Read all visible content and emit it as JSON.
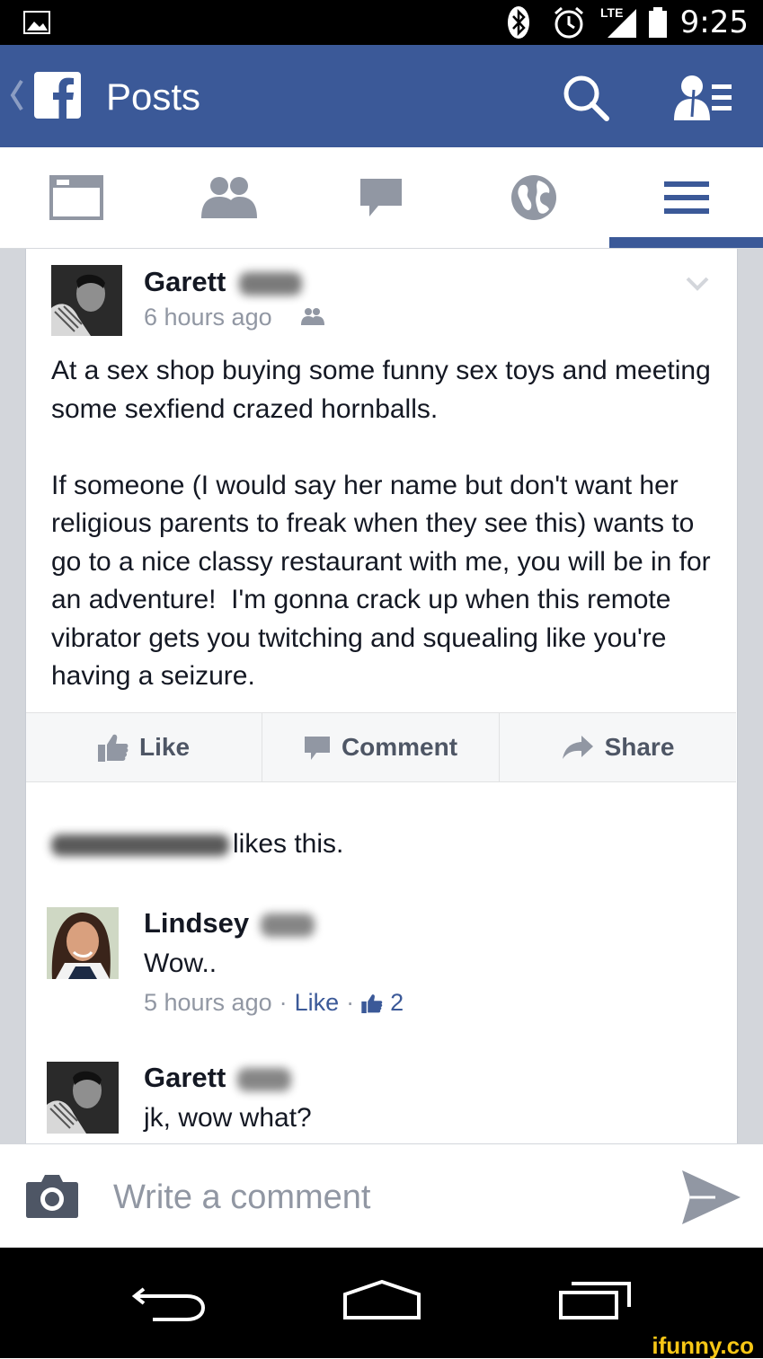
{
  "status_bar": {
    "time": "9:25",
    "network_label": "LTE",
    "icons": [
      "gallery-icon",
      "bluetooth-icon",
      "alarm-icon",
      "signal-icon",
      "battery-icon"
    ]
  },
  "app_bar": {
    "title": "Posts",
    "icons": [
      "back-chevron-icon",
      "facebook-logo-icon",
      "search-icon",
      "friend-requests-icon"
    ],
    "brand_color": "#3b5998"
  },
  "nav_tabs": [
    {
      "name": "news-feed",
      "icon": "news-feed-icon"
    },
    {
      "name": "friends",
      "icon": "friends-icon"
    },
    {
      "name": "messages",
      "icon": "messages-icon"
    },
    {
      "name": "notifications",
      "icon": "globe-icon"
    },
    {
      "name": "more",
      "icon": "menu-icon",
      "active": true
    }
  ],
  "post": {
    "author": "Garett",
    "time": "6 hours ago",
    "text": "At a sex shop buying some funny sex toys and meeting some sexfiend crazed hornballs.\n\nIf someone (I would say her name but don't want her religious parents to freak when they see this) wants to go to a nice classy restaurant with me, you will be in for an adventure!  I'm gonna crack up when this remote vibrator gets you twitching and squealing like you're having a seizure.",
    "actions": {
      "like": "Like",
      "comment": "Comment",
      "share": "Share"
    },
    "likes_text": "likes this."
  },
  "comments": [
    {
      "author": "Lindsey",
      "text": "Wow..",
      "time": "5 hours ago",
      "separator": "·",
      "like_label": "Like",
      "like_count": "2"
    },
    {
      "author": "Garett",
      "text": "jk, wow what?"
    }
  ],
  "composer": {
    "placeholder": "Write a comment"
  },
  "watermark": "ifunny.co"
}
